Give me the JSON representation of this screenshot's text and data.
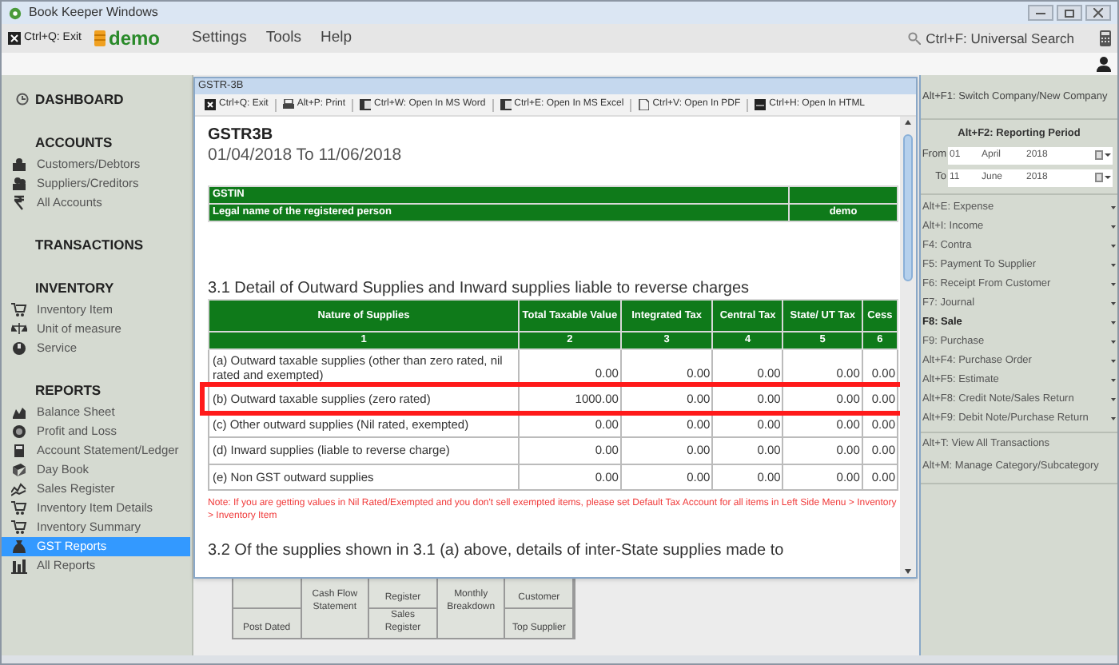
{
  "window": {
    "title": "Book Keeper Windows"
  },
  "toolbar": {
    "exit": "Ctrl+Q: Exit",
    "company": "demo",
    "menus": [
      "Settings",
      "Tools",
      "Help"
    ],
    "search": "Ctrl+F: Universal Search"
  },
  "sidebar": {
    "sections": [
      {
        "title": "DASHBOARD"
      },
      {
        "title": "ACCOUNTS",
        "items": [
          {
            "label": "Customers/Debtors",
            "selected": false
          },
          {
            "label": "Suppliers/Creditors",
            "selected": false
          },
          {
            "label": "All Accounts",
            "selected": false
          }
        ]
      },
      {
        "title": "TRANSACTIONS"
      },
      {
        "title": "INVENTORY",
        "items": [
          {
            "label": "Inventory Item",
            "selected": false
          },
          {
            "label": "Unit of measure",
            "selected": false
          },
          {
            "label": "Service",
            "selected": false
          }
        ]
      },
      {
        "title": "REPORTS",
        "items": [
          {
            "label": "Balance Sheet",
            "selected": false
          },
          {
            "label": "Profit and Loss",
            "selected": false
          },
          {
            "label": "Account Statement/Ledger",
            "selected": false
          },
          {
            "label": "Day Book",
            "selected": false
          },
          {
            "label": "Sales Register",
            "selected": false
          },
          {
            "label": "Inventory Item Details",
            "selected": false
          },
          {
            "label": "Inventory Summary",
            "selected": false
          },
          {
            "label": "GST Reports",
            "selected": true
          },
          {
            "label": "All Reports",
            "selected": false
          }
        ]
      }
    ]
  },
  "tiles": [
    {
      "kind": "stacked",
      "labels": [
        "Post Dated"
      ]
    },
    {
      "kind": "tall",
      "labels": [
        "Cash Flow Statement"
      ]
    },
    {
      "kind": "stacked",
      "labels": [
        "Register",
        "Sales Register"
      ]
    },
    {
      "kind": "tall",
      "labels": [
        "Monthly Breakdown"
      ]
    },
    {
      "kind": "stacked",
      "labels": [
        "Customer",
        "Top Supplier"
      ]
    }
  ],
  "dialog": {
    "title": "GSTR-3B",
    "buttons": [
      "Ctrl+Q: Exit",
      "Alt+P: Print",
      "Ctrl+W: Open In MS Word",
      "Ctrl+E: Open In MS Excel",
      "Ctrl+V: Open In PDF",
      "Ctrl+H: Open In HTML"
    ],
    "report_title": "GSTR3B",
    "period": "01/04/2018 To 11/06/2018",
    "info": [
      {
        "label": "GSTIN"
      },
      {
        "label": "Legal name of the registered person",
        "value": "demo"
      }
    ],
    "section_heading": "3.1 Detail of Outward Supplies and Inward supplies liable to reverse charges",
    "columns": [
      {
        "label": "Nature of Supplies",
        "number": "1"
      },
      {
        "label": "Total Taxable Value",
        "number": "2"
      },
      {
        "label": "Integrated Tax",
        "number": "3"
      },
      {
        "label": "Central Tax",
        "number": "4"
      },
      {
        "label": "State/ UT Tax",
        "number": "5"
      },
      {
        "label": "Cess",
        "number": "6"
      }
    ],
    "rows": [
      {
        "nature": "(a) Outward taxable supplies (other than zero rated, nil rated and exempted)",
        "values": [
          "0.00",
          "0.00",
          "0.00",
          "0.00",
          "0.00"
        ],
        "highlighted": false
      },
      {
        "nature": "(b) Outward taxable supplies (zero rated)",
        "values": [
          "1000.00",
          "0.00",
          "0.00",
          "0.00",
          "0.00"
        ],
        "highlighted": true
      },
      {
        "nature": "(c) Other outward supplies (Nil rated, exempted)",
        "values": [
          "0.00",
          "0.00",
          "0.00",
          "0.00",
          "0.00"
        ],
        "highlighted": false
      },
      {
        "nature": "(d) Inward supplies (liable to reverse charge)",
        "values": [
          "0.00",
          "0.00",
          "0.00",
          "0.00",
          "0.00"
        ],
        "highlighted": false
      },
      {
        "nature": "(e) Non GST outward supplies",
        "values": [
          "0.00",
          "0.00",
          "0.00",
          "0.00",
          "0.00"
        ],
        "highlighted": false
      }
    ],
    "note": "Note: If you are getting values in Nil Rated/Exempted and you don't sell exempted items, please set Default Tax Account for all items in Left Side Menu > Inventory > Inventory Item",
    "next_heading": "3.2 Of the supplies shown in 3.1 (a) above, details of inter-State supplies made to"
  },
  "right_panel": {
    "switch": "Alt+F1: Switch Company/New Company",
    "period_title": "Alt+F2: Reporting Period",
    "dates": [
      {
        "label": "From",
        "day": "01",
        "month": "April",
        "year": "2018"
      },
      {
        "label": "To",
        "day": "11",
        "month": "June",
        "year": "2018"
      }
    ],
    "actions": [
      {
        "label": "Alt+E: Expense",
        "selected": false
      },
      {
        "label": "Alt+I: Income",
        "selected": false
      },
      {
        "label": "F4: Contra",
        "selected": false
      },
      {
        "label": "F5: Payment To Supplier",
        "selected": false
      },
      {
        "label": "F6: Receipt From Customer",
        "selected": false
      },
      {
        "label": "F7: Journal",
        "selected": false
      },
      {
        "label": "F8: Sale",
        "selected": true
      },
      {
        "label": "F9: Purchase",
        "selected": false
      },
      {
        "label": "Alt+F4: Purchase Order",
        "selected": false
      },
      {
        "label": "Alt+F5: Estimate",
        "selected": false
      },
      {
        "label": "Alt+F8: Credit Note/Sales Return",
        "selected": false
      },
      {
        "label": "Alt+F9: Debit Note/Purchase Return",
        "selected": false
      }
    ],
    "links": [
      "Alt+T: View All Transactions",
      "Alt+M: Manage Category/Subcategory"
    ]
  }
}
